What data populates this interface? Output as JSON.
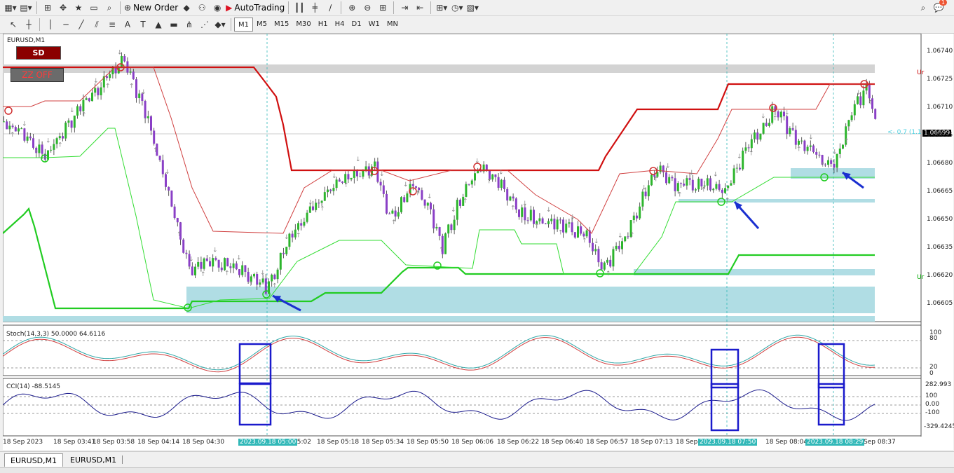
{
  "toolbar": {
    "new_order_label": "New Order",
    "autotrading_label": "AutoTrading",
    "timeframes": [
      "M1",
      "M5",
      "M15",
      "M30",
      "H1",
      "H4",
      "D1",
      "W1",
      "MN"
    ],
    "active_timeframe": "M1",
    "notification_count": "1"
  },
  "chart": {
    "symbol_label": "EURUSD,M1",
    "sd_button": "SD",
    "zz_button": "ZZ OFF",
    "current_price": "1.06699",
    "price_annotation": "<- 0.7 (1.1",
    "up_label": "Ur",
    "price_levels": [
      "1.06740",
      "1.06725",
      "1.06710",
      "1.06695",
      "1.06680",
      "1.06665",
      "1.06650",
      "1.06635",
      "1.06620",
      "1.06605"
    ],
    "stoch_label": "Stoch(14,3,3) 50.0000 64.6116",
    "stoch_levels": [
      "100",
      "80",
      "20",
      "0"
    ],
    "cci_label": "CCI(14) -88.5145",
    "cci_levels": [
      "282.993",
      "100",
      "0.00",
      "-100",
      "-329.4245"
    ],
    "time_labels": [
      "18 Sep 2023",
      "18 Sep 03:41",
      "18 Sep 03:58",
      "18 Sep 04:14",
      "18 Sep 04:30",
      "18 S",
      "05:02",
      "18 Sep 05:18",
      "18 Sep 05:34",
      "18 Sep 05:50",
      "18 Sep 06:06",
      "18 Sep 06:22",
      "18 Sep 06:40",
      "18 Sep 06:57",
      "18 Sep 07:13",
      "18 Sep",
      "18 Sep 08:04",
      "Sep 08:37"
    ],
    "time_highlights": [
      "2023.09.18 05:00",
      "2023.09.18 07:50",
      "2023.09.18 08:29"
    ],
    "colors": {
      "bull": "#2db52d",
      "bear": "#8a3fc6",
      "resistance": "#e02020",
      "support": "#22cc22",
      "zone": "#b0dde4",
      "arrow": "#1a2fd0",
      "cci_line": "#1a1a8c"
    }
  },
  "tabs": [
    "EURUSD,M1",
    "EURUSD,M1"
  ]
}
